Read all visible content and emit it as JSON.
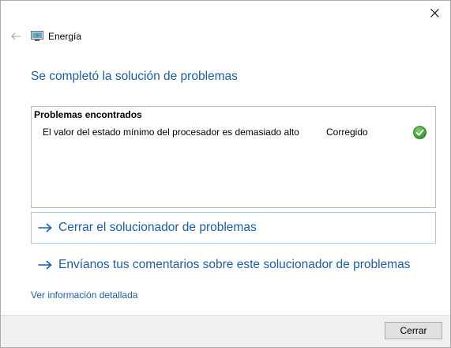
{
  "window": {
    "title": "Energía",
    "close_icon": "close-icon",
    "back_icon": "back-arrow-icon",
    "app_icon": "power-options-icon"
  },
  "main": {
    "title": "Se completó la solución de problemas"
  },
  "problems": {
    "header": "Problemas encontrados",
    "rows": [
      {
        "description": "El valor del estado mínimo del procesador es demasiado alto",
        "status": "Corregido",
        "status_icon": "green-check-icon"
      }
    ]
  },
  "options": [
    {
      "label": "Cerrar el solucionador de problemas",
      "icon": "arrow-right-icon",
      "focused": true
    },
    {
      "label": "Envíanos tus comentarios sobre este solucionador de problemas",
      "icon": "arrow-right-icon",
      "focused": false
    }
  ],
  "detail_link": "Ver información detallada",
  "footer": {
    "close_button_label": "Cerrar"
  },
  "colors": {
    "accent": "#1a5ea8",
    "check_green": "#2fa22f"
  }
}
